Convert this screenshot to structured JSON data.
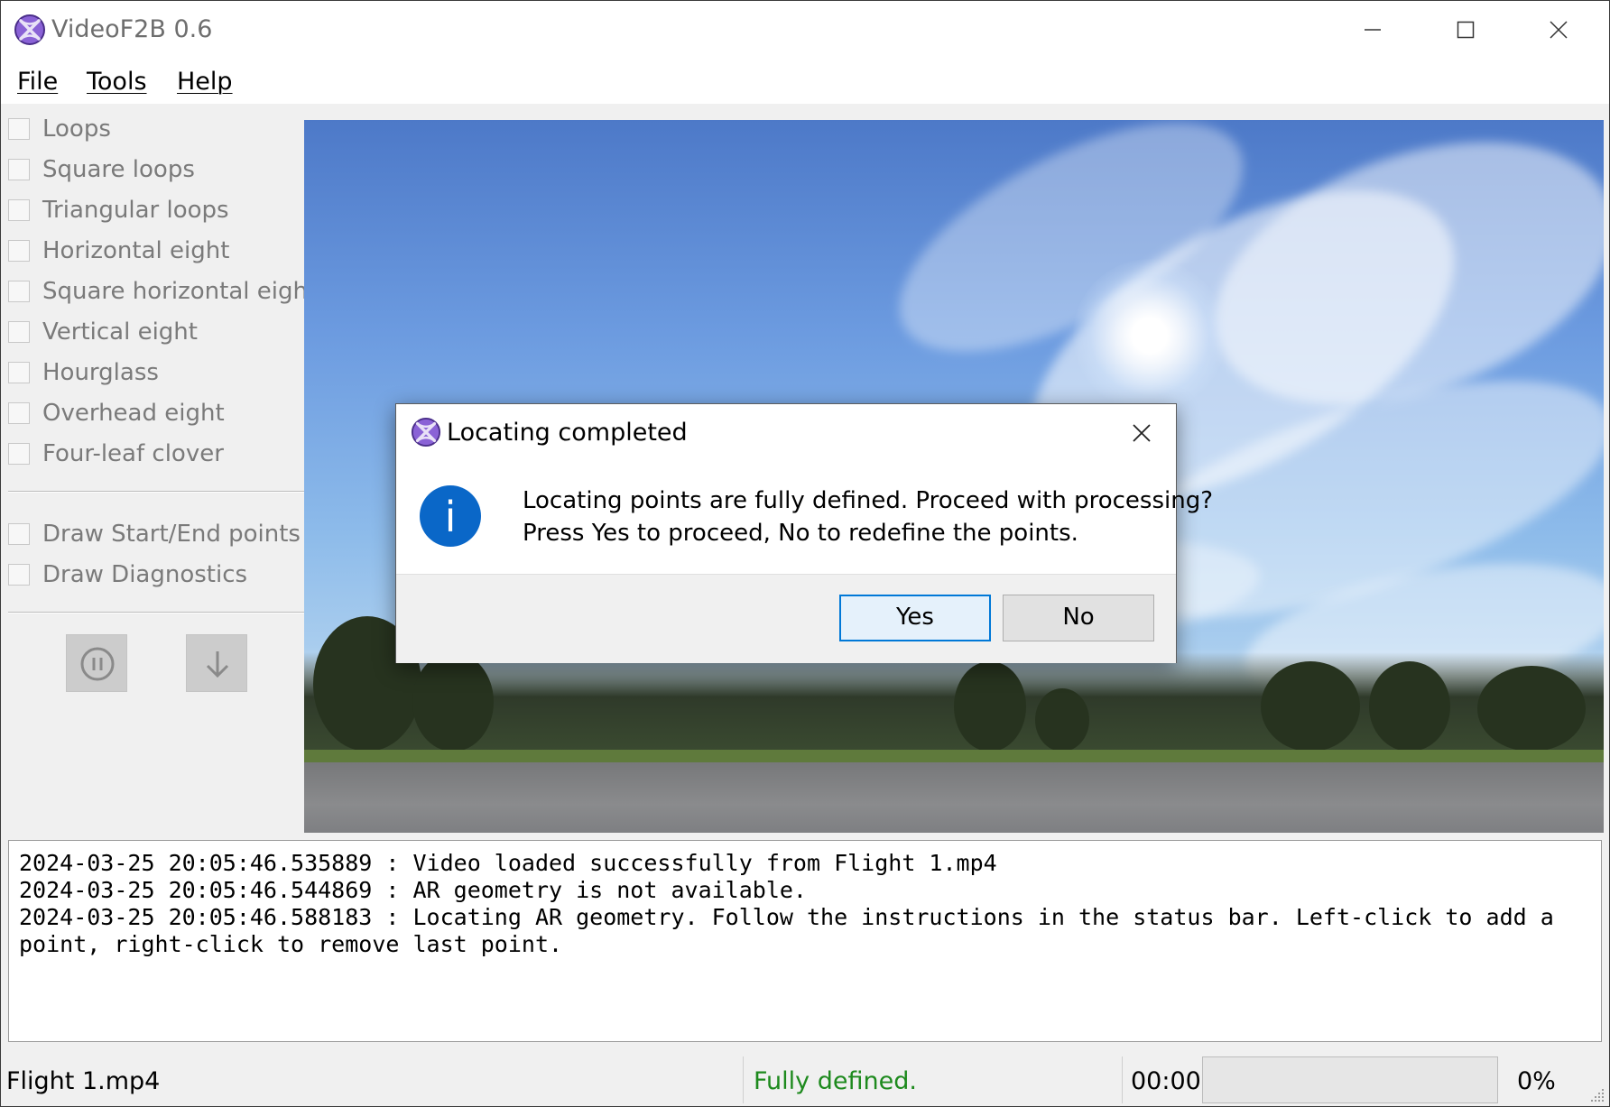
{
  "window": {
    "title": "VideoF2B 0.6"
  },
  "menu": {
    "file": "File",
    "tools": "Tools",
    "help": "Help"
  },
  "figures": [
    "Loops",
    "Square loops",
    "Triangular loops",
    "Horizontal eight",
    "Square horizontal eight",
    "Vertical eight",
    "Hourglass",
    "Overhead eight",
    "Four-leaf clover"
  ],
  "draw_options": [
    "Draw Start/End points",
    "Draw Diagnostics"
  ],
  "log": [
    "2024-03-25 20:05:46.535889 : Video loaded successfully from Flight 1.mp4",
    "2024-03-25 20:05:46.544869 : AR geometry is not available.",
    "2024-03-25 20:05:46.588183 : Locating AR geometry. Follow the instructions in the status bar. Left-click to add a",
    "point, right-click to remove last point."
  ],
  "status": {
    "file": "Flight 1.mp4",
    "message": "Fully defined.",
    "time": "00:00",
    "progress": 0,
    "percent_text": "0%",
    "message_color": "#1e8a1e"
  },
  "dialog": {
    "title": "Locating completed",
    "line1": "Locating points are fully defined. Proceed with processing?",
    "line2": "Press Yes to proceed, No to redefine the points.",
    "yes": "Yes",
    "no": "No",
    "icon": "info-icon",
    "info_glyph": "i"
  },
  "colors": {
    "accent": "#0078d7",
    "info_blue": "#0a67c8",
    "logo_purple": "#7b4fc4"
  }
}
